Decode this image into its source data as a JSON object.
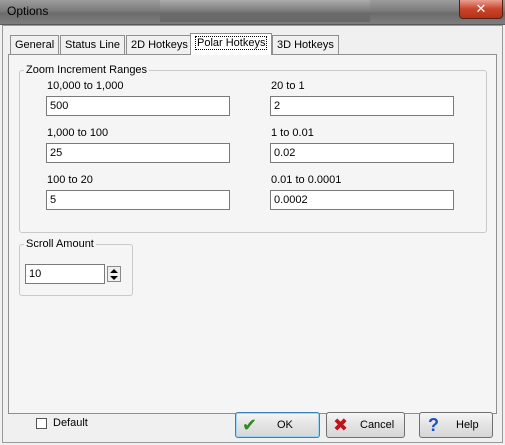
{
  "window": {
    "title": "Options",
    "close_glyph": "✕"
  },
  "tabs": [
    {
      "label": "General",
      "active": false
    },
    {
      "label": "Status Line",
      "active": false
    },
    {
      "label": "2D Hotkeys",
      "active": false
    },
    {
      "label": "Polar Hotkeys",
      "active": true
    },
    {
      "label": "3D Hotkeys",
      "active": false
    }
  ],
  "zoom_group": {
    "legend": "Zoom Increment Ranges",
    "fields": [
      {
        "label": "10,000 to 1,000",
        "value": "500"
      },
      {
        "label": "20 to 1",
        "value": "2"
      },
      {
        "label": "1,000 to 100",
        "value": "25"
      },
      {
        "label": "1 to 0.01",
        "value": "0.02"
      },
      {
        "label": "100 to 20",
        "value": "5"
      },
      {
        "label": "0.01 to 0.0001",
        "value": "0.0002"
      }
    ]
  },
  "scroll_group": {
    "legend": "Scroll Amount",
    "value": "10"
  },
  "footer": {
    "default_label": "Default",
    "default_checked": false,
    "ok_label": "OK",
    "cancel_label": "Cancel",
    "help_label": "Help"
  },
  "colors": {
    "ok_icon": "#2e8b1e",
    "cancel_icon": "#c0121a",
    "help_icon": "#1d4fbf"
  }
}
